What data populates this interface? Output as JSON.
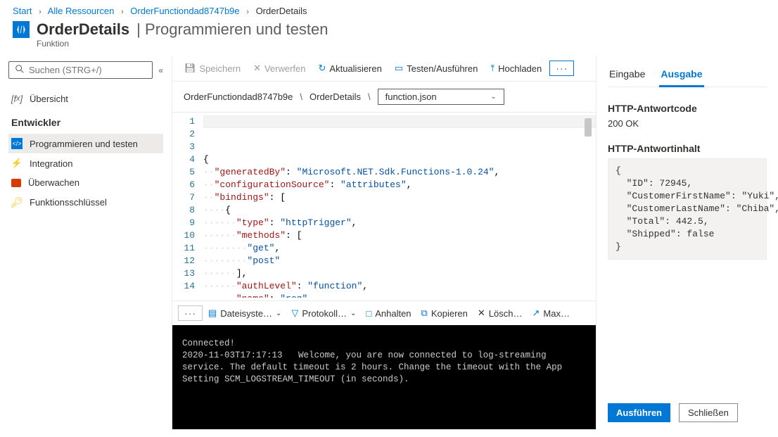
{
  "breadcrumb": [
    {
      "label": "Start",
      "link": true
    },
    {
      "label": "Alle Ressourcen",
      "link": true
    },
    {
      "label": "OrderFunctiondad8747b9e",
      "link": true
    },
    {
      "label": "OrderDetails",
      "link": false
    }
  ],
  "header": {
    "title": "OrderDetails",
    "subtitle_suffix": "Programmieren und testen",
    "kind": "Funktion"
  },
  "sidebar": {
    "search_placeholder": "Suchen (STRG+/)",
    "overview_label": "Übersicht",
    "section_label": "Entwickler",
    "items": [
      {
        "label": "Programmieren und testen",
        "icon": "code-icon",
        "active": true
      },
      {
        "label": "Integration",
        "icon": "bolt-icon",
        "active": false
      },
      {
        "label": "Überwachen",
        "icon": "monitor-icon",
        "active": false
      },
      {
        "label": "Funktionsschlüssel",
        "icon": "key-icon",
        "active": false
      }
    ]
  },
  "toolbar": {
    "save": "Speichern",
    "discard": "Verwerfen",
    "refresh": "Aktualisieren",
    "testrun": "Testen/Ausführen",
    "upload": "Hochladen"
  },
  "pathbar": {
    "func": "OrderFunctiondad8747b9e",
    "sub": "OrderDetails",
    "file": "function.json"
  },
  "editor": {
    "line_count": 14,
    "json": {
      "generatedBy": "Microsoft.NET.Sdk.Functions-1.0.24",
      "configurationSource": "attributes",
      "bindings": [
        {
          "type": "httpTrigger",
          "methods": [
            "get",
            "post"
          ],
          "authLevel": "function",
          "name": "req"
        }
      ]
    }
  },
  "console_toolbar": {
    "filesystem": "Dateisyste…",
    "protocol": "Protokoll…",
    "pause": "Anhalten",
    "copy": "Kopieren",
    "clear": "Lösch…",
    "max": "Max…"
  },
  "console": {
    "connected": "Connected!",
    "timestamp": "2020-11-03T17:17:13",
    "message": "Welcome, you are now connected to log-streaming service. The default timeout is 2 hours. Change the timeout with the App Setting SCM_LOGSTREAM_TIMEOUT (in seconds)."
  },
  "right": {
    "tab_input": "Eingabe",
    "tab_output": "Ausgabe",
    "resp_code_h": "HTTP-Antwortcode",
    "resp_code": "200 OK",
    "resp_body_h": "HTTP-Antwortinhalt",
    "resp_body_lines": [
      "{",
      "  \"ID\": 72945,",
      "  \"CustomerFirstName\": \"Yuki\",",
      "  \"CustomerLastName\": \"Chiba\",",
      "  \"Total\": 442.5,",
      "  \"Shipped\": false",
      "}"
    ],
    "run": "Ausführen",
    "close": "Schließen"
  }
}
